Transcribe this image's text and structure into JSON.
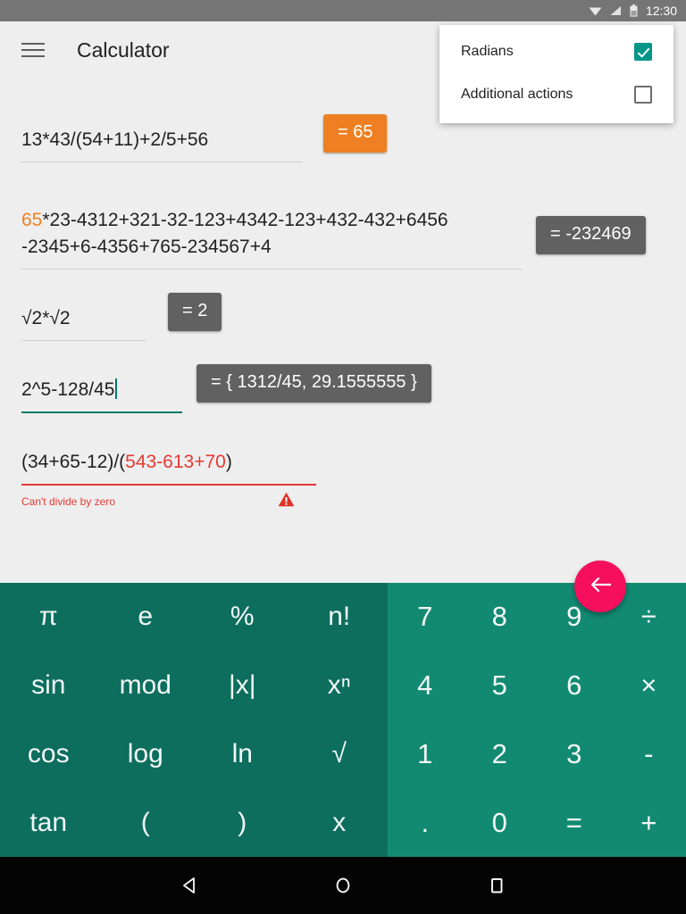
{
  "status_bar": {
    "time": "12:30",
    "icons": [
      "wifi-icon",
      "cellular-signal-icon",
      "battery-icon"
    ]
  },
  "app_bar": {
    "menu_icon": "hamburger-menu-icon",
    "title": "Calculator"
  },
  "overflow_menu": {
    "visible": true,
    "items": [
      {
        "label": "Radians",
        "checked": true
      },
      {
        "label": "Additional actions",
        "checked": false
      }
    ],
    "checked_color": "#009688"
  },
  "expressions": [
    {
      "id": "row-1",
      "expr_plain": "13*43/(54+11)+2/5+56",
      "segments": [
        {
          "text": "13*43/(54+11)+2/5+56",
          "style": "normal"
        }
      ],
      "result": "= 65",
      "result_style": "orange",
      "state": "normal"
    },
    {
      "id": "row-2",
      "expr_plain": "65*23-4312+321-32-123+4342-123+432-432+6456-2345+6-4356+765-234567+4",
      "segments": [
        {
          "text": "65",
          "style": "reference"
        },
        {
          "text": "*23-4312+321-32-123+4342-123+432-432+6456\n-2345+6-4356+765-234567+4",
          "style": "normal"
        }
      ],
      "result": "= -232469",
      "result_style": "grey",
      "state": "normal"
    },
    {
      "id": "row-3",
      "expr_plain": "√2*√2",
      "segments": [
        {
          "text": "√2*√2",
          "style": "normal"
        }
      ],
      "result": "= 2",
      "result_style": "grey",
      "state": "normal"
    },
    {
      "id": "row-4",
      "expr_plain": "2^5-128/45",
      "segments": [
        {
          "text": "2^5-128/45",
          "style": "normal"
        }
      ],
      "result": "= { 1312/45, 29.1555555 }",
      "result_style": "grey",
      "state": "focused",
      "cursor": true
    },
    {
      "id": "row-5",
      "expr_plain": "(34+65-12)/(543-613+70)",
      "segments": [
        {
          "text": "(34+65-12)/(",
          "style": "normal"
        },
        {
          "text": "543-613+70",
          "style": "error"
        },
        {
          "text": ")",
          "style": "normal"
        }
      ],
      "result": null,
      "result_style": null,
      "state": "error",
      "error_text": "Can't divide by zero",
      "error_icon": "warning-triangle-icon"
    }
  ],
  "keypad": {
    "left_keys": [
      "π",
      "e",
      "%",
      "n!",
      "sin",
      "mod",
      "|x|",
      "xⁿ",
      "cos",
      "log",
      "ln",
      "√",
      "tan",
      "(",
      ")",
      "x"
    ],
    "right_keys": [
      "7",
      "8",
      "9",
      "÷",
      "4",
      "5",
      "6",
      "×",
      "1",
      "2",
      "3",
      "-",
      ".",
      "0",
      "=",
      "+"
    ],
    "left_bg": "#0d6e5e",
    "right_bg": "#128a72"
  },
  "fab": {
    "icon": "backspace-arrow-left-icon",
    "color": "#f50f5c"
  },
  "nav_bar": {
    "buttons": [
      "back-icon",
      "home-icon",
      "recents-icon"
    ]
  },
  "colors": {
    "accent_orange": "#ee8023",
    "result_grey": "#616161",
    "error_red": "#e53935",
    "teal": "#00796b"
  }
}
